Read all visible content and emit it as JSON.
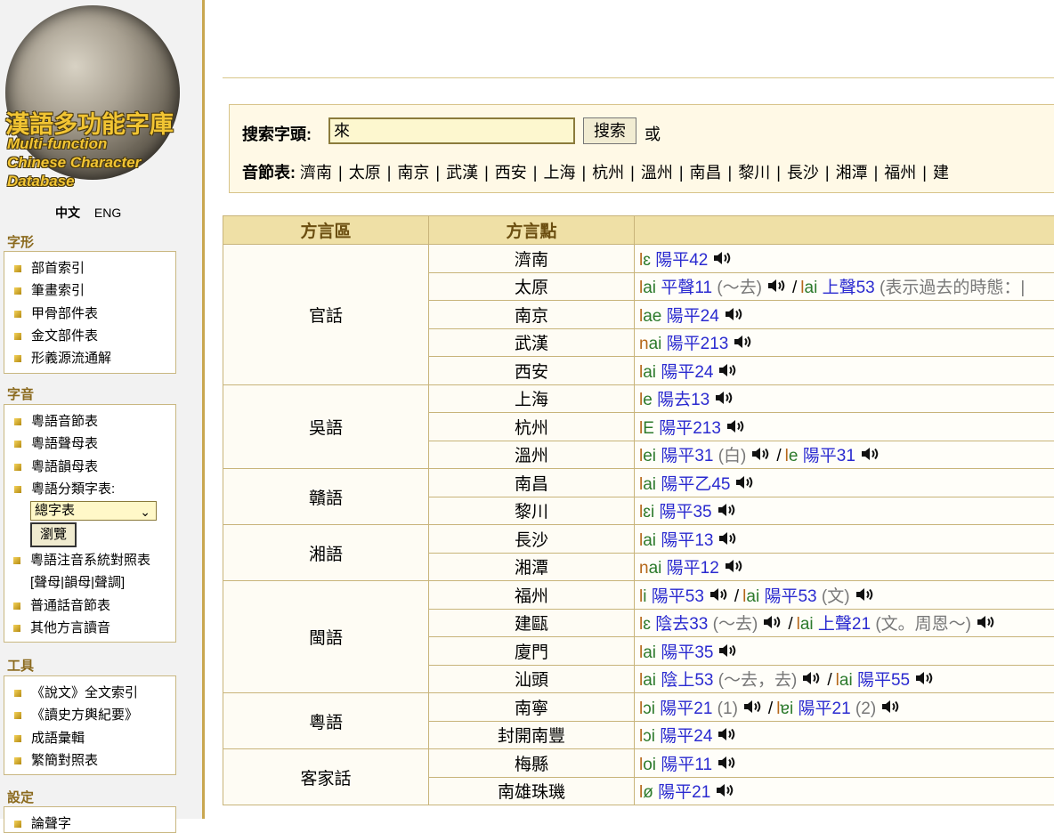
{
  "sidebar": {
    "logo": {
      "title_zh": "漢語多功能字庫",
      "title_en": [
        "Multi-function",
        "Chinese Character",
        "Database"
      ]
    },
    "lang": {
      "zh": "中文",
      "en": "ENG"
    },
    "sections": [
      {
        "head": "字形",
        "items": [
          "部首索引",
          "筆畫索引",
          "甲骨部件表",
          "金文部件表",
          "形義源流通解"
        ]
      },
      {
        "head": "字音",
        "items": [
          "粵語音節表",
          "粵語聲母表",
          "粵語韻母表",
          "粵語分類字表:"
        ],
        "dropdown_value": "總字表",
        "browse_label": "瀏覽",
        "items2": [
          "粵語注音系統對照表",
          "[聲母|韻母|聲調]",
          "普通話音節表",
          "其他方言讀音"
        ]
      },
      {
        "head": "工具",
        "items": [
          "《說文》全文索引",
          "《讀史方輿紀要》",
          "成語彙輯",
          "繁簡對照表"
        ]
      },
      {
        "head": "設定",
        "items": [
          "論聲字"
        ]
      }
    ]
  },
  "search": {
    "label": "搜索字頭:",
    "value": "來",
    "button": "搜索",
    "or": "或",
    "syll_label": "音節表:",
    "cities": [
      "濟南",
      "太原",
      "南京",
      "武漢",
      "西安",
      "上海",
      "杭州",
      "溫州",
      "南昌",
      "黎川",
      "長沙",
      "湘潭",
      "福州",
      "建"
    ]
  },
  "table": {
    "headers": [
      "方言區",
      "方言點",
      ""
    ],
    "regions": [
      {
        "name": "官話",
        "rows": [
          {
            "point": "濟南",
            "readings": [
              {
                "ini": "l",
                "fin": "ɛ",
                "tone": "陽平42",
                "note": ""
              }
            ]
          },
          {
            "point": "太原",
            "readings": [
              {
                "ini": "l",
                "fin": "ai",
                "tone": "平聲11",
                "note": "(～去)"
              },
              {
                "ini": "l",
                "fin": "ai",
                "tone": "上聲53",
                "note": "(表示過去的時態：|"
              }
            ]
          },
          {
            "point": "南京",
            "readings": [
              {
                "ini": "l",
                "fin": "ae",
                "tone": "陽平24",
                "note": ""
              }
            ]
          },
          {
            "point": "武漢",
            "readings": [
              {
                "ini": "n",
                "fin": "ai",
                "tone": "陽平213",
                "note": ""
              }
            ]
          },
          {
            "point": "西安",
            "readings": [
              {
                "ini": "l",
                "fin": "ai",
                "tone": "陽平24",
                "note": ""
              }
            ]
          }
        ]
      },
      {
        "name": "吳語",
        "rows": [
          {
            "point": "上海",
            "readings": [
              {
                "ini": "l",
                "fin": "e",
                "tone": "陽去13",
                "note": ""
              }
            ]
          },
          {
            "point": "杭州",
            "readings": [
              {
                "ini": "l",
                "fin": "E",
                "tone": "陽平213",
                "note": ""
              }
            ]
          },
          {
            "point": "溫州",
            "readings": [
              {
                "ini": "l",
                "fin": "ei",
                "tone": "陽平31",
                "note": "(白)"
              },
              {
                "ini": "l",
                "fin": "e",
                "tone": "陽平31",
                "note": ""
              }
            ]
          }
        ]
      },
      {
        "name": "贛語",
        "rows": [
          {
            "point": "南昌",
            "readings": [
              {
                "ini": "l",
                "fin": "ai",
                "tone": "陽平乙45",
                "note": ""
              }
            ]
          },
          {
            "point": "黎川",
            "readings": [
              {
                "ini": "l",
                "fin": "ɛi",
                "tone": "陽平35",
                "note": ""
              }
            ]
          }
        ]
      },
      {
        "name": "湘語",
        "rows": [
          {
            "point": "長沙",
            "readings": [
              {
                "ini": "l",
                "fin": "ai",
                "tone": "陽平13",
                "note": ""
              }
            ]
          },
          {
            "point": "湘潭",
            "readings": [
              {
                "ini": "n",
                "fin": "ai",
                "tone": "陽平12",
                "note": ""
              }
            ]
          }
        ]
      },
      {
        "name": "閩語",
        "rows": [
          {
            "point": "福州",
            "readings": [
              {
                "ini": "l",
                "fin": "i",
                "tone": "陽平53",
                "note": ""
              },
              {
                "ini": "l",
                "fin": "ai",
                "tone": "陽平53",
                "note": "(文)"
              }
            ]
          },
          {
            "point": "建甌",
            "readings": [
              {
                "ini": "l",
                "fin": "ɛ",
                "tone": "陰去33",
                "note": "(～去)"
              },
              {
                "ini": "l",
                "fin": "ai",
                "tone": "上聲21",
                "note": "(文。周恩～)"
              }
            ]
          },
          {
            "point": "廈門",
            "readings": [
              {
                "ini": "l",
                "fin": "ai",
                "tone": "陽平35",
                "note": ""
              }
            ]
          },
          {
            "point": "汕頭",
            "readings": [
              {
                "ini": "l",
                "fin": "ai",
                "tone": "陰上53",
                "note": "(～去，去)"
              },
              {
                "ini": "l",
                "fin": "ai",
                "tone": "陽平55",
                "note": ""
              }
            ]
          }
        ]
      },
      {
        "name": "粵語",
        "rows": [
          {
            "point": "南寧",
            "readings": [
              {
                "ini": "l",
                "fin": "ɔi",
                "tone": "陽平21",
                "note": "(1)"
              },
              {
                "ini": "l",
                "fin": "ɐi",
                "tone": "陽平21",
                "note": "(2)"
              }
            ]
          },
          {
            "point": "封開南豐",
            "readings": [
              {
                "ini": "l",
                "fin": "ɔi",
                "tone": "陽平24",
                "note": ""
              }
            ]
          }
        ]
      },
      {
        "name": "客家話",
        "rows": [
          {
            "point": "梅縣",
            "readings": [
              {
                "ini": "l",
                "fin": "oi",
                "tone": "陽平11",
                "note": ""
              }
            ]
          },
          {
            "point": "南雄珠璣",
            "readings": [
              {
                "ini": "l",
                "fin": "ø",
                "tone": "陽平21",
                "note": ""
              }
            ]
          }
        ]
      }
    ]
  }
}
